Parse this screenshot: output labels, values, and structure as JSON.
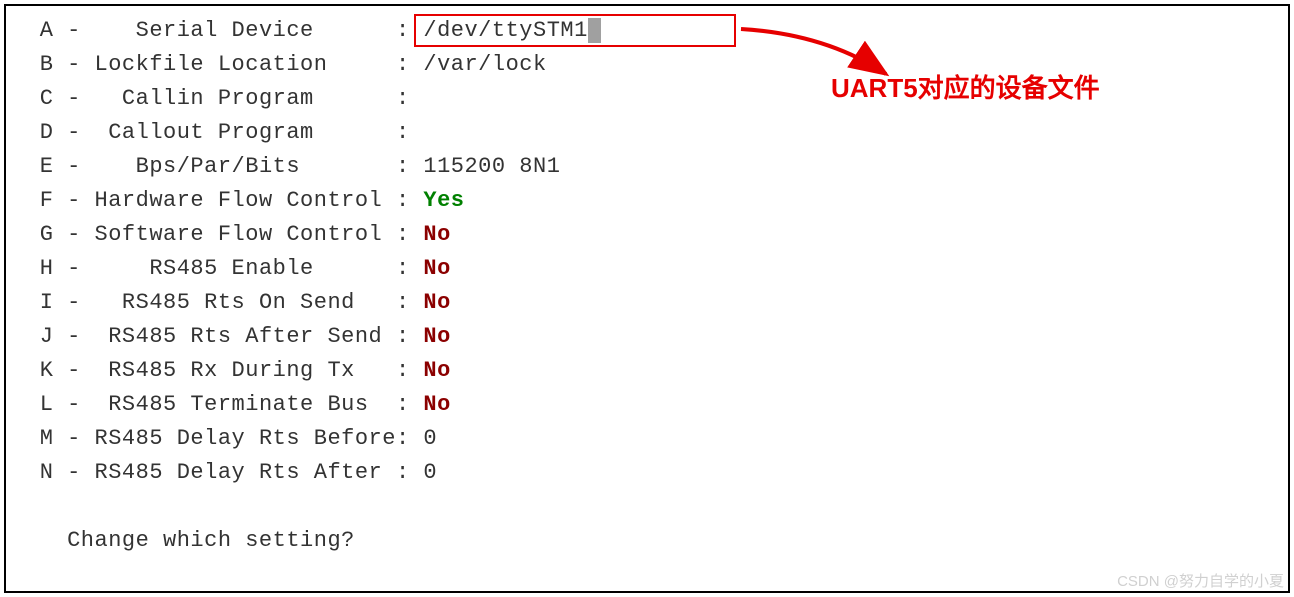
{
  "settings": {
    "A": {
      "key": "A",
      "label": "   Serial Device      ",
      "sep": ":",
      "value": "/dev/ttySTM1",
      "type": "highlighted"
    },
    "B": {
      "key": "B",
      "label": "Lockfile Location     ",
      "sep": ":",
      "value": "/var/lock"
    },
    "C": {
      "key": "C",
      "label": "  Callin Program      ",
      "sep": ":",
      "value": ""
    },
    "D": {
      "key": "D",
      "label": " Callout Program      ",
      "sep": ":",
      "value": ""
    },
    "E": {
      "key": "E",
      "label": "   Bps/Par/Bits       ",
      "sep": ":",
      "value": "115200 8N1"
    },
    "F": {
      "key": "F",
      "label": "Hardware Flow Control ",
      "sep": ":",
      "value": "Yes",
      "color": "yes"
    },
    "G": {
      "key": "G",
      "label": "Software Flow Control ",
      "sep": ":",
      "value": "No",
      "color": "no"
    },
    "H": {
      "key": "H",
      "label": "    RS485 Enable      ",
      "sep": ":",
      "value": "No",
      "color": "no"
    },
    "I": {
      "key": "I",
      "label": "  RS485 Rts On Send   ",
      "sep": ":",
      "value": "No",
      "color": "no"
    },
    "J": {
      "key": "J",
      "label": " RS485 Rts After Send ",
      "sep": ":",
      "value": "No",
      "color": "no"
    },
    "K": {
      "key": "K",
      "label": " RS485 Rx During Tx   ",
      "sep": ":",
      "value": "No",
      "color": "no"
    },
    "L": {
      "key": "L",
      "label": " RS485 Terminate Bus  ",
      "sep": ":",
      "value": "No",
      "color": "no"
    },
    "M": {
      "key": "M",
      "label": "RS485 Delay Rts Before",
      "sep": ":",
      "value": "0"
    },
    "N": {
      "key": "N",
      "label": "RS485 Delay Rts After ",
      "sep": ":",
      "value": "0"
    }
  },
  "prompt": "   Change which setting?",
  "annotation": "UART5对应的设备文件",
  "watermark": "CSDN @努力自学的小夏"
}
